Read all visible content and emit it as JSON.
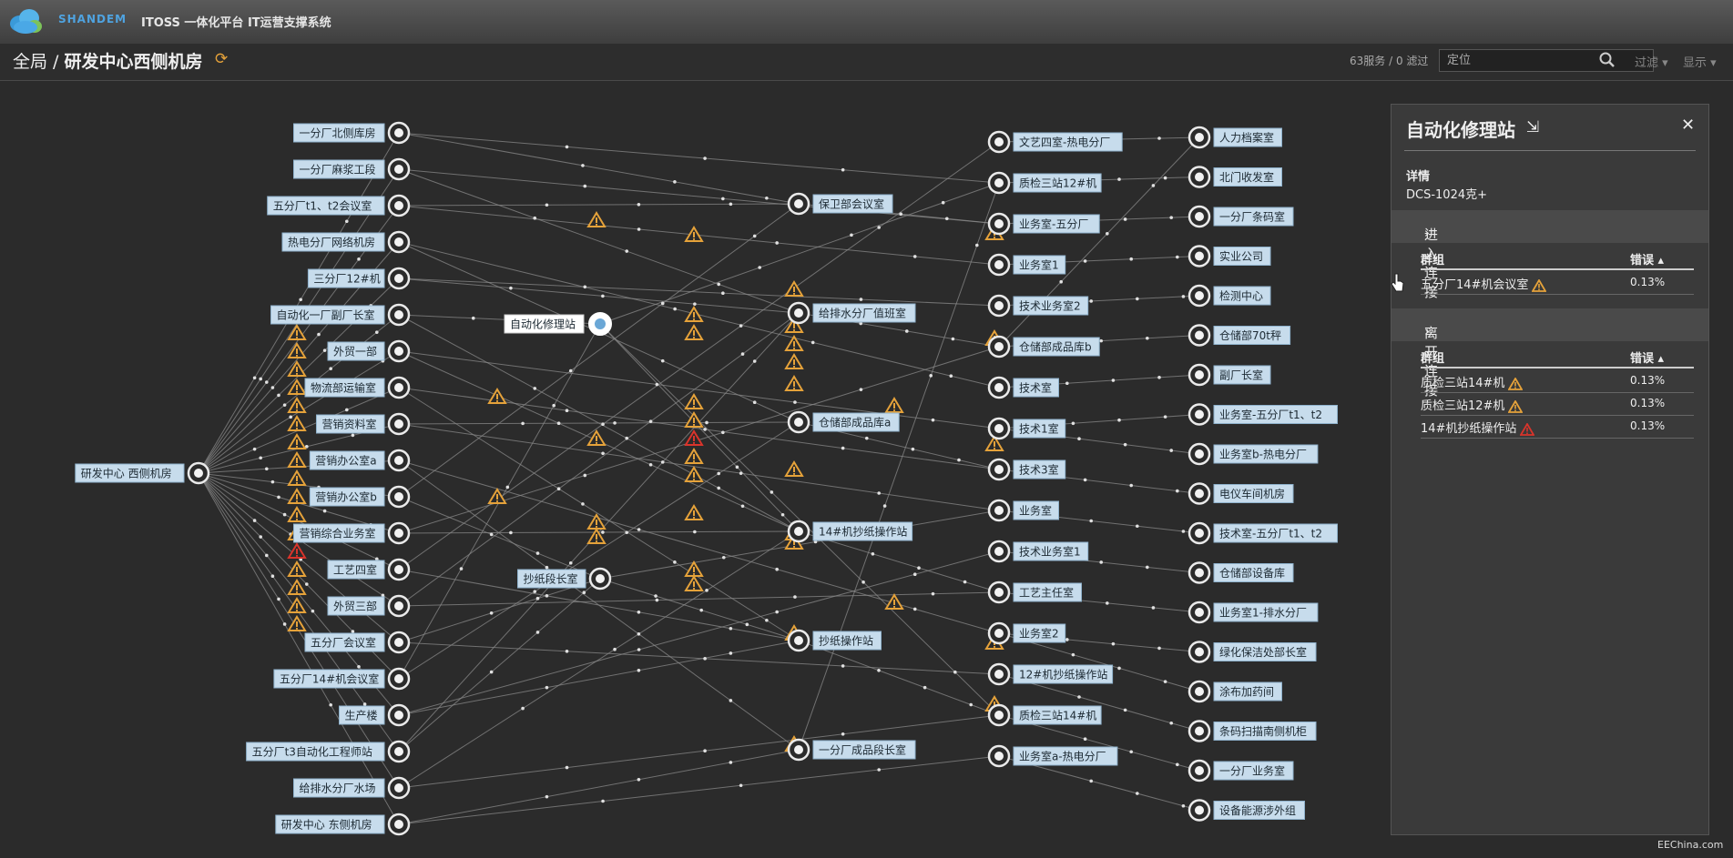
{
  "app": {
    "brand": "SHANDEM",
    "title": "ITOSS 一体化平台 IT运营支撑系统"
  },
  "breadcrumb": {
    "root": "全局",
    "separator": " / ",
    "current": "研发中心西侧机房"
  },
  "toolbar": {
    "service_count": "63服务 / 0 滤过",
    "search_placeholder": "定位",
    "filter_label": "过滤 ▾",
    "display_label": "显示 ▾"
  },
  "colors": {
    "warning": "#e5a23a",
    "error": "#d9342b",
    "label_bg": "#c7dcec"
  },
  "graph": {
    "root": {
      "label": "研发中心 西侧机房"
    },
    "selected": {
      "label": "自动化修理站"
    },
    "col1": [
      "一分厂北侧库房",
      "一分厂麻浆工段",
      "五分厂t1、t2会议室",
      "热电分厂网络机房",
      "三分厂12#机",
      "自动化一厂副厂长室",
      "外贸一部",
      "物流部运输室",
      "营销资料室",
      "营销办公室a",
      "营销办公室b",
      "营销综合业务室",
      "工艺四室",
      "外贸三部",
      "五分厂会议室",
      "五分厂14#机会议室",
      "生产楼",
      "五分厂t3自动化工程师站",
      "给排水分厂水场",
      "研发中心 东侧机房"
    ],
    "col2": [
      "自动化修理站",
      "抄纸段长室"
    ],
    "col3": [
      "保卫部会议室",
      "给排水分厂值班室",
      "仓储部成品库a",
      "14#机抄纸操作站",
      "抄纸操作站",
      "一分厂成品段长室"
    ],
    "col4": [
      "文艺四室-热电分厂",
      "质检三站12#机",
      "业务室-五分厂",
      "业务室1",
      "技术业务室2",
      "仓储部成品库b",
      "技术室",
      "技术1室",
      "技术3室",
      "业务室",
      "技术业务室1",
      "工艺主任室",
      "业务室2",
      "12#机抄纸操作站",
      "质检三站14#机",
      "业务室a-热电分厂"
    ],
    "col5": [
      "人力档案室",
      "北门收发室",
      "一分厂条码室",
      "实业公司",
      "检测中心",
      "仓储部70t秤",
      "副厂长室",
      "业务室-五分厂t1、t2",
      "业务室b-热电分厂",
      "电仪车间机房",
      "技术室-五分厂t1、t2",
      "仓储部设备库",
      "业务室1-排水分厂",
      "绿化保洁处部长室",
      "涂布加药间",
      "条码扫描南侧机柜",
      "一分厂业务室",
      "设备能源涉外组"
    ]
  },
  "panel": {
    "title": "自动化修理站",
    "detail_label": "详情",
    "detail_value": "DCS-1024克+",
    "incoming": {
      "section": "进入连接",
      "col_group": "群组",
      "col_error": "错误 ▴",
      "rows": [
        {
          "name": "五分厂14#机会议室",
          "status": "warning",
          "error": "0.13%"
        }
      ]
    },
    "outgoing": {
      "section": "离开连接",
      "col_group": "群组",
      "col_error": "错误 ▴",
      "rows": [
        {
          "name": "质检三站14#机",
          "status": "warning",
          "error": "0.13%"
        },
        {
          "name": "质检三站12#机",
          "status": "warning",
          "error": "0.13%"
        },
        {
          "name": "14#机抄纸操作站",
          "status": "error",
          "error": "0.13%"
        }
      ]
    }
  },
  "watermark": "EEChina.com"
}
